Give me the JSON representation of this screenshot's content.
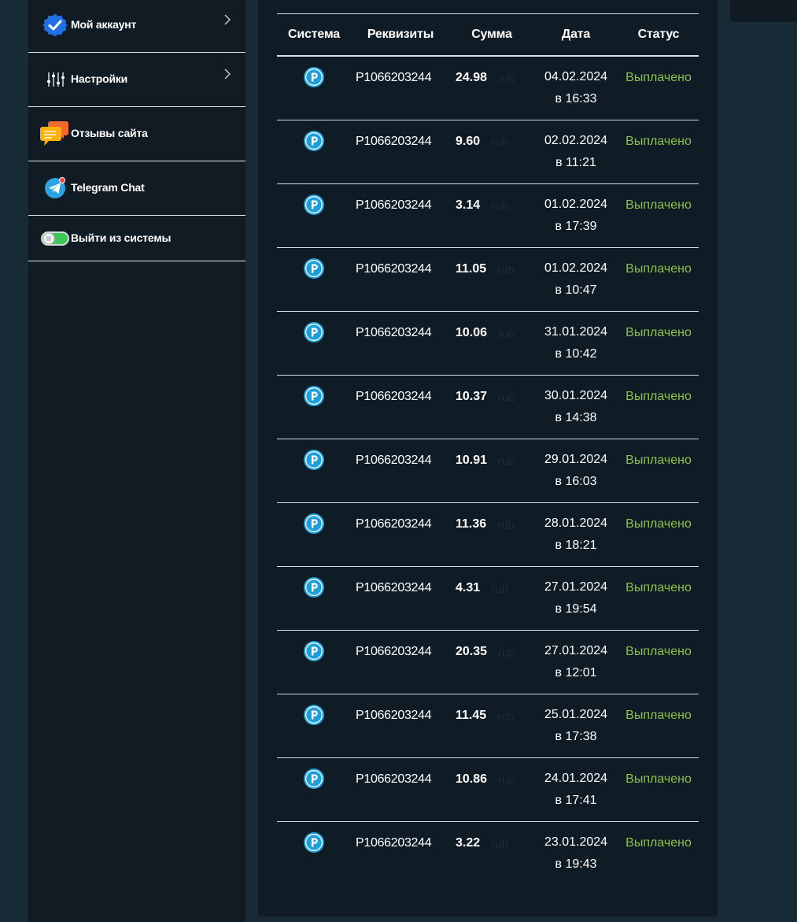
{
  "sidebar": {
    "items": [
      {
        "label": "Мой аккаунт",
        "icon": "verified-badge-icon",
        "chevron": true
      },
      {
        "label": "Настройки",
        "icon": "sliders-icon",
        "chevron": true
      },
      {
        "label": "Отзывы сайта",
        "icon": "chat-bubbles-icon",
        "chevron": false
      },
      {
        "label": "Telegram Chat",
        "icon": "telegram-icon",
        "chevron": false
      },
      {
        "label": "Выйти из системы",
        "icon": "toggle-switch-icon",
        "chevron": false
      }
    ]
  },
  "table": {
    "headers": {
      "system": "Система",
      "details": "Реквизиты",
      "amount": "Сумма",
      "date": "Дата",
      "status": "Статус"
    },
    "rows": [
      {
        "system_icon": "payeer-icon",
        "details": "P1066203244",
        "amount": "24.98",
        "unit": "rub",
        "date": "04.02.2024",
        "time": "в 16:33",
        "status": "Выплачено"
      },
      {
        "system_icon": "payeer-icon",
        "details": "P1066203244",
        "amount": "9.60",
        "unit": "rub",
        "date": "02.02.2024",
        "time": "в 11:21",
        "status": "Выплачено"
      },
      {
        "system_icon": "payeer-icon",
        "details": "P1066203244",
        "amount": "3.14",
        "unit": "rub",
        "date": "01.02.2024",
        "time": "в 17:39",
        "status": "Выплачено"
      },
      {
        "system_icon": "payeer-icon",
        "details": "P1066203244",
        "amount": "11.05",
        "unit": "rub",
        "date": "01.02.2024",
        "time": "в 10:47",
        "status": "Выплачено"
      },
      {
        "system_icon": "payeer-icon",
        "details": "P1066203244",
        "amount": "10.06",
        "unit": "rub",
        "date": "31.01.2024",
        "time": "в 10:42",
        "status": "Выплачено"
      },
      {
        "system_icon": "payeer-icon",
        "details": "P1066203244",
        "amount": "10.37",
        "unit": "rub",
        "date": "30.01.2024",
        "time": "в 14:38",
        "status": "Выплачено"
      },
      {
        "system_icon": "payeer-icon",
        "details": "P1066203244",
        "amount": "10.91",
        "unit": "rub",
        "date": "29.01.2024",
        "time": "в 16:03",
        "status": "Выплачено"
      },
      {
        "system_icon": "payeer-icon",
        "details": "P1066203244",
        "amount": "11.36",
        "unit": "rub",
        "date": "28.01.2024",
        "time": "в 18:21",
        "status": "Выплачено"
      },
      {
        "system_icon": "payeer-icon",
        "details": "P1066203244",
        "amount": "4.31",
        "unit": "rub",
        "date": "27.01.2024",
        "time": "в 19:54",
        "status": "Выплачено"
      },
      {
        "system_icon": "payeer-icon",
        "details": "P1066203244",
        "amount": "20.35",
        "unit": "rub",
        "date": "27.01.2024",
        "time": "в 12:01",
        "status": "Выплачено"
      },
      {
        "system_icon": "payeer-icon",
        "details": "P1066203244",
        "amount": "11.45",
        "unit": "rub",
        "date": "25.01.2024",
        "time": "в 17:38",
        "status": "Выплачено"
      },
      {
        "system_icon": "payeer-icon",
        "details": "P1066203244",
        "amount": "10.86",
        "unit": "rub",
        "date": "24.01.2024",
        "time": "в 17:41",
        "status": "Выплачено"
      },
      {
        "system_icon": "payeer-icon",
        "details": "P1066203244",
        "amount": "3.22",
        "unit": "rub",
        "date": "23.01.2024",
        "time": "в 19:43",
        "status": "Выплачено"
      }
    ]
  },
  "colors": {
    "background": "#182a35",
    "panel": "#101c25",
    "sidebar": "#111b24",
    "status_paid": "#8bc34a",
    "payeer_blue": "#1e9fd9"
  }
}
